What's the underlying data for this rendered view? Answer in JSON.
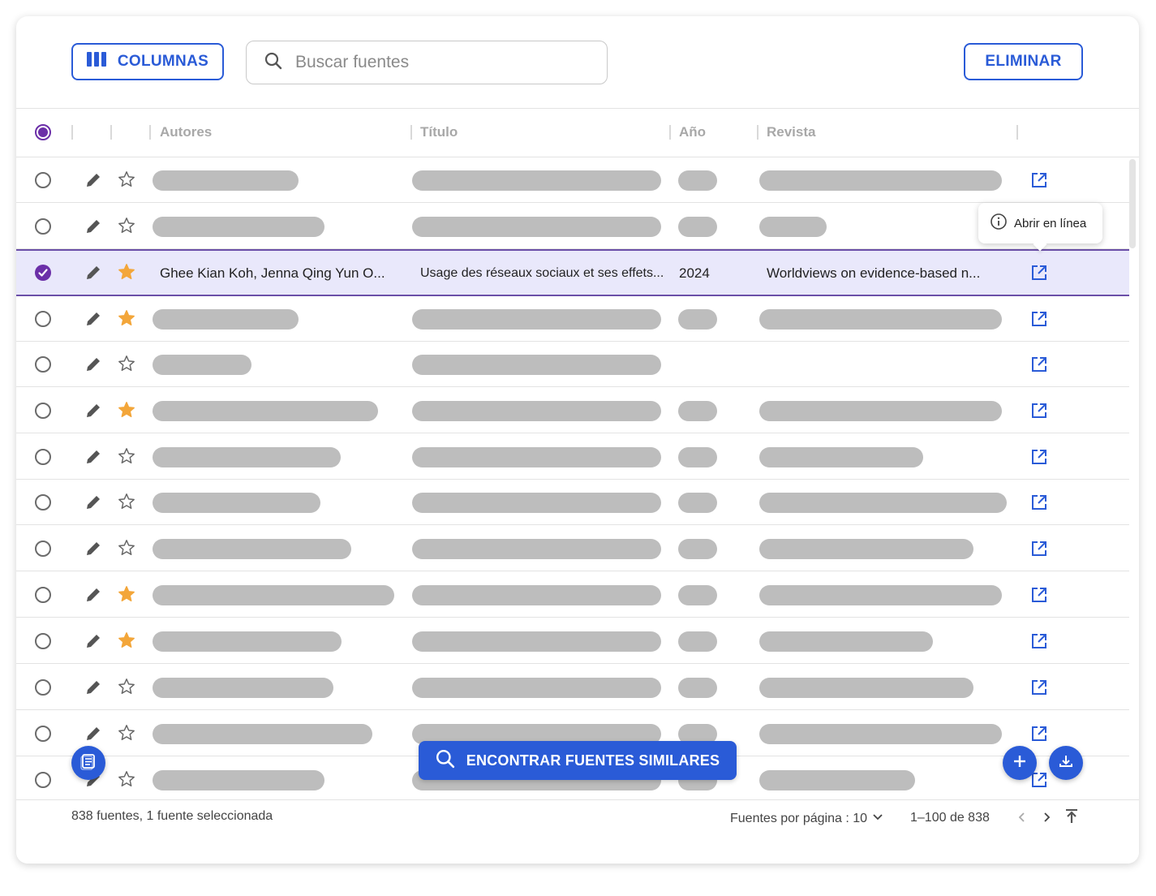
{
  "toolbar": {
    "columns_label": "COLUMNAS",
    "search_placeholder": "Buscar fuentes",
    "delete_label": "ELIMINAR"
  },
  "table": {
    "headers": {
      "authors": "Autores",
      "title": "Título",
      "year": "Año",
      "journal": "Revista"
    },
    "selected_row": {
      "authors": "Ghee Kian Koh, Jenna Qing Yun O...",
      "title": "Usage des réseaux sociaux et ses effets...",
      "year": "2024",
      "journal": "Worldviews on evidence-based n..."
    },
    "starred_rows": [
      2,
      3,
      5,
      9,
      10
    ]
  },
  "tooltip": {
    "text": "Abrir en línea"
  },
  "actions": {
    "find_similar_label": "ENCONTRAR FUENTES SIMILARES"
  },
  "footer": {
    "summary": "838 fuentes, 1 fuente seleccionada",
    "per_page": "Fuentes por página : 10",
    "range": "1–100 de 838"
  },
  "colors": {
    "accent": "#2a5bd7",
    "selected_purple": "#6b2fa8",
    "star_active": "#f3a63a",
    "placeholder_bar": "#bdbdbd",
    "selected_row_bg": "#e9e8fb"
  },
  "icons": [
    "columns-icon",
    "search-icon",
    "edit-icon",
    "star-icon",
    "open-external-icon",
    "info-icon",
    "notes-icon",
    "add-icon",
    "download-icon",
    "upload-icon",
    "chevron-left-icon",
    "chevron-right-icon",
    "chevron-down-icon",
    "check-icon"
  ]
}
